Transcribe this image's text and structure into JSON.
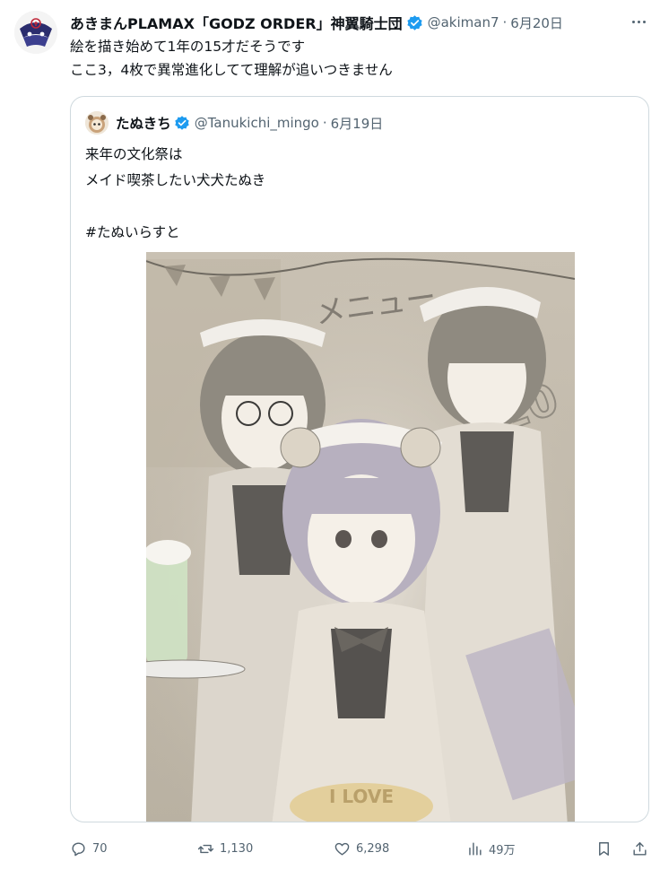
{
  "post": {
    "display_name": "あきまんPLAMAX「GODZ ORDER」神翼騎士団",
    "handle": "@akiman7",
    "separator": "·",
    "date": "6月20日",
    "text_lines": [
      "絵を描き始めて1年の15才だそうです",
      "ここ3，4枚で異常進化してて理解が追いつきません"
    ]
  },
  "quote": {
    "display_name": "たぬきち",
    "handle": "@Tanukichi_mingo",
    "separator": "·",
    "date": "6月19日",
    "text_lines": [
      "来年の文化祭は",
      "メイド喫茶したい犬犬たぬき",
      "",
      "#たぬいらすと"
    ],
    "image_lettering": [
      "メニュー",
      "20",
      "I LOVE"
    ]
  },
  "actions": {
    "replies": "70",
    "reposts": "1,130",
    "likes": "6,298",
    "views": "49万"
  },
  "colors": {
    "text_primary": "#0f1419",
    "text_secondary": "#536471",
    "verified_blue": "#1d9bf0",
    "border": "#cfd9de"
  },
  "icons": [
    "more-icon",
    "verified-icon",
    "reply-icon",
    "repost-icon",
    "like-icon",
    "views-icon",
    "bookmark-icon",
    "share-icon"
  ]
}
